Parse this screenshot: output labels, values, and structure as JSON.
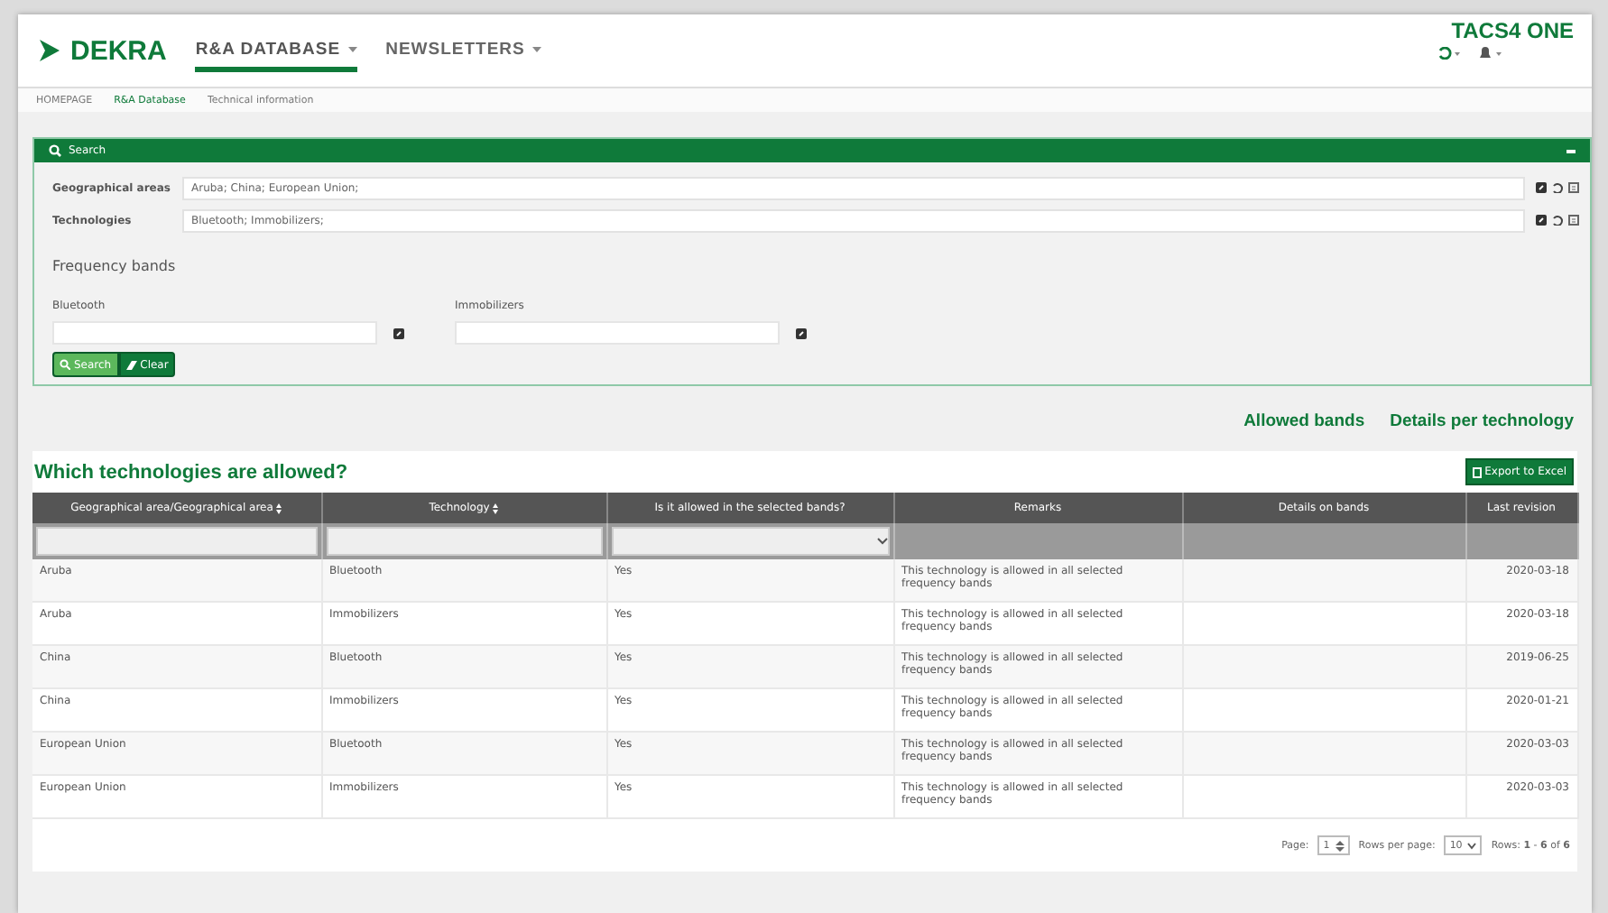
{
  "header": {
    "logo": "DEKRA",
    "nav": [
      {
        "label": "R&A DATABASE",
        "selected": true
      },
      {
        "label": "NEWSLETTERS",
        "selected": false
      }
    ],
    "brand": "TACS4 ONE"
  },
  "breadcrumb": [
    "HOMEPAGE",
    "R&A Database",
    "Technical information"
  ],
  "search_panel": {
    "title": "Search",
    "filters": [
      {
        "label": "Geographical areas",
        "value": "Aruba; China; European Union;"
      },
      {
        "label": "Technologies",
        "value": "Bluetooth; Immobilizers;"
      }
    ],
    "frequency_title": "Frequency bands",
    "bands": [
      {
        "label": "Bluetooth"
      },
      {
        "label": "Immobilizers"
      }
    ],
    "buttons": [
      "Search",
      "Clear"
    ]
  },
  "links": [
    "Allowed bands",
    "Details per technology"
  ],
  "results": {
    "title": "Which technologies are allowed?",
    "export": "Export to Excel",
    "columns": [
      {
        "label": "Geographical area/Geographical area",
        "sortable": true,
        "kind": "text"
      },
      {
        "label": "Technology",
        "sortable": true,
        "kind": "text"
      },
      {
        "label": "Is it allowed in the selected bands?",
        "sortable": false,
        "kind": "select"
      },
      {
        "label": "Remarks",
        "sortable": false,
        "kind": "plain"
      },
      {
        "label": "Details on bands",
        "sortable": false,
        "kind": "plain"
      },
      {
        "label": "Last revision",
        "sortable": false,
        "kind": "plain"
      }
    ],
    "rows": [
      [
        "Aruba",
        "Bluetooth",
        "Yes",
        "This technology is allowed in all selected frequency bands",
        "",
        "2020-03-18"
      ],
      [
        "Aruba",
        "Immobilizers",
        "Yes",
        "This technology is allowed in all selected frequency bands",
        "",
        "2020-03-18"
      ],
      [
        "China",
        "Bluetooth",
        "Yes",
        "This technology is allowed in all selected frequency bands",
        "",
        "2019-06-25"
      ],
      [
        "China",
        "Immobilizers",
        "Yes",
        "This technology is allowed in all selected frequency bands",
        "",
        "2020-01-21"
      ],
      [
        "European Union",
        "Bluetooth",
        "Yes",
        "This technology is allowed in all selected frequency bands",
        "",
        "2020-03-03"
      ],
      [
        "European Union",
        "Immobilizers",
        "Yes",
        "This technology is allowed in all selected frequency bands",
        "",
        "2020-03-03"
      ]
    ],
    "pager": {
      "page_label": "Page:",
      "page": "1",
      "rows_label": "Rows per page:",
      "rows_per_page": "10",
      "summary": "Rows: **1** - **6** of **6**"
    }
  }
}
